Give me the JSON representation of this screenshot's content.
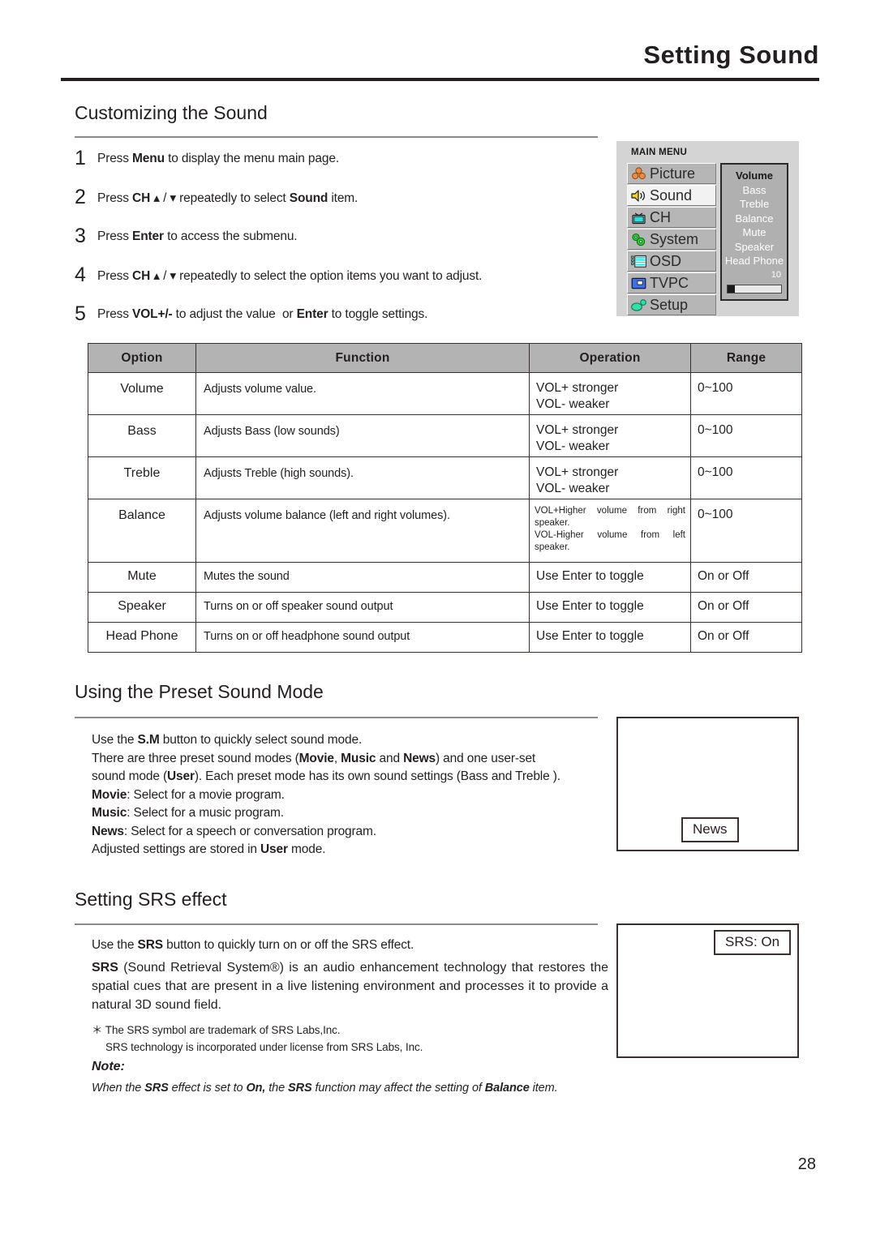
{
  "header": {
    "title": "Setting Sound"
  },
  "page_number": "28",
  "sections": {
    "customizing": {
      "heading": "Customizing the Sound",
      "steps": [
        {
          "num": "1",
          "html": "Press <b>Menu</b> to display the menu main page.",
          "text": "Press Menu to display the menu main page."
        },
        {
          "num": "2",
          "html": "Press <b>CH</b> ▴ / ▾ repeatedly to select <b>Sound</b> item.",
          "text": "Press CH up/down repeatedly to select Sound item."
        },
        {
          "num": "3",
          "html": "Press <b>Enter</b> to access the submenu.",
          "text": "Press Enter to access the submenu."
        },
        {
          "num": "4",
          "html": "Press <b>CH</b> ▴ / ▾ repeatedly to select the option items you want to adjust.",
          "text": "Press CH up/down repeatedly to select the option items you want to adjust."
        },
        {
          "num": "5",
          "html": "Press <b>VOL+/-</b> to adjust the value&nbsp; or <b>Enter</b> to toggle settings.",
          "text": "Press VOL+/- to adjust the value or Enter to toggle settings."
        }
      ]
    },
    "preset": {
      "heading": "Using the Preset Sound Mode",
      "lines": [
        "Use the <b>S.M</b> button to quickly select sound mode.",
        "There are three preset sound modes (<b>Movie</b>, <b>Music</b> and <b>News</b>) and one user-set",
        "sound mode (<b>User</b>). Each preset mode has its own sound settings (Bass and Treble ).",
        "<b>Movie</b>: Select for a movie program.",
        "<b>Music</b>: Select for a music program.",
        "<b>News</b>: Select for a speech or conversation program.",
        "Adjusted settings are stored in <b>User</b> mode."
      ],
      "tv_chip_label": "News"
    },
    "srs": {
      "heading": "Setting SRS effect",
      "line1": "Use the <b>SRS</b> button to quickly turn on or off the SRS effect.",
      "paragraph": "<b>SRS</b> (Sound Retrieval System®) is an audio enhancement technology that restores the spatial cues that are present in a live listening environment and processes it to provide a natural 3D sound field.",
      "footnotes": [
        "＊ The SRS symbol are trademark of SRS Labs,Inc.",
        "SRS technology is incorporated under license from SRS Labs, Inc."
      ],
      "tv_chip_label": "SRS:  On"
    }
  },
  "note": {
    "label": "Note:",
    "text": "When the <b>SRS</b> effect is set to <b>On,</b> the <b>SRS</b> function may affect the setting of <b>Balance</b> item."
  },
  "osd": {
    "title": "MAIN MENU",
    "menu_items": [
      {
        "label": "Picture",
        "icon": "picture-icon",
        "selected": false
      },
      {
        "label": "Sound",
        "icon": "speaker-icon",
        "selected": true
      },
      {
        "label": "CH",
        "icon": "tv-icon",
        "selected": false
      },
      {
        "label": "System",
        "icon": "system-gears-icon",
        "selected": false
      },
      {
        "label": "OSD",
        "icon": "osd-lines-icon",
        "selected": false
      },
      {
        "label": "TVPC",
        "icon": "tvpc-icon",
        "selected": false
      },
      {
        "label": "Setup",
        "icon": "setup-icon",
        "selected": false
      }
    ],
    "submenu_items": [
      {
        "label": "Volume",
        "selected": true
      },
      {
        "label": "Bass",
        "selected": false
      },
      {
        "label": "Treble",
        "selected": false
      },
      {
        "label": "Balance",
        "selected": false
      },
      {
        "label": "Mute",
        "selected": false
      },
      {
        "label": "Speaker",
        "selected": false
      },
      {
        "label": "Head Phone",
        "selected": false
      }
    ],
    "value": "10",
    "value_percent": 14
  },
  "table": {
    "headers": [
      "Option",
      "Function",
      "Operation",
      "Range"
    ],
    "rows": [
      {
        "option": "Volume",
        "function": "Adjusts volume value.",
        "operation": "VOL+  stronger\nVOL-  weaker",
        "range": "0~100"
      },
      {
        "option": "Bass",
        "function": "Adjusts Bass (low sounds)",
        "operation": "VOL+  stronger\nVOL-  weaker",
        "range": "0~100"
      },
      {
        "option": "Treble",
        "function": "Adjusts Treble (high sounds).",
        "operation": "VOL+  stronger\nVOL-  weaker",
        "range": "0~100"
      },
      {
        "option": "Balance",
        "function": "Adjusts volume balance (left and right volumes).",
        "operation": "VOL+Higher volume from right speaker.\nVOL-Higher volume from left speaker.",
        "range": "0~100"
      },
      {
        "option": "Mute",
        "function": "Mutes the sound",
        "operation": "Use Enter to toggle",
        "range": "On or Off"
      },
      {
        "option": "Speaker",
        "function": "Turns on or off speaker sound output",
        "operation": "Use Enter to toggle",
        "range": "On or Off"
      },
      {
        "option": "Head Phone",
        "function": "Turns on or off headphone sound output",
        "operation": "Use Enter to toggle",
        "range": "On or Off"
      }
    ]
  },
  "colors": {
    "ink": "#231f20",
    "rule": "#8a8a8a",
    "table_header_bg": "#b3b3b3",
    "table_border": "#3b302e",
    "osd_bg": "#d4d4d4",
    "osd_item_bg": "#b6b6b6",
    "osd_sub_bg": "#b0b0b0"
  }
}
